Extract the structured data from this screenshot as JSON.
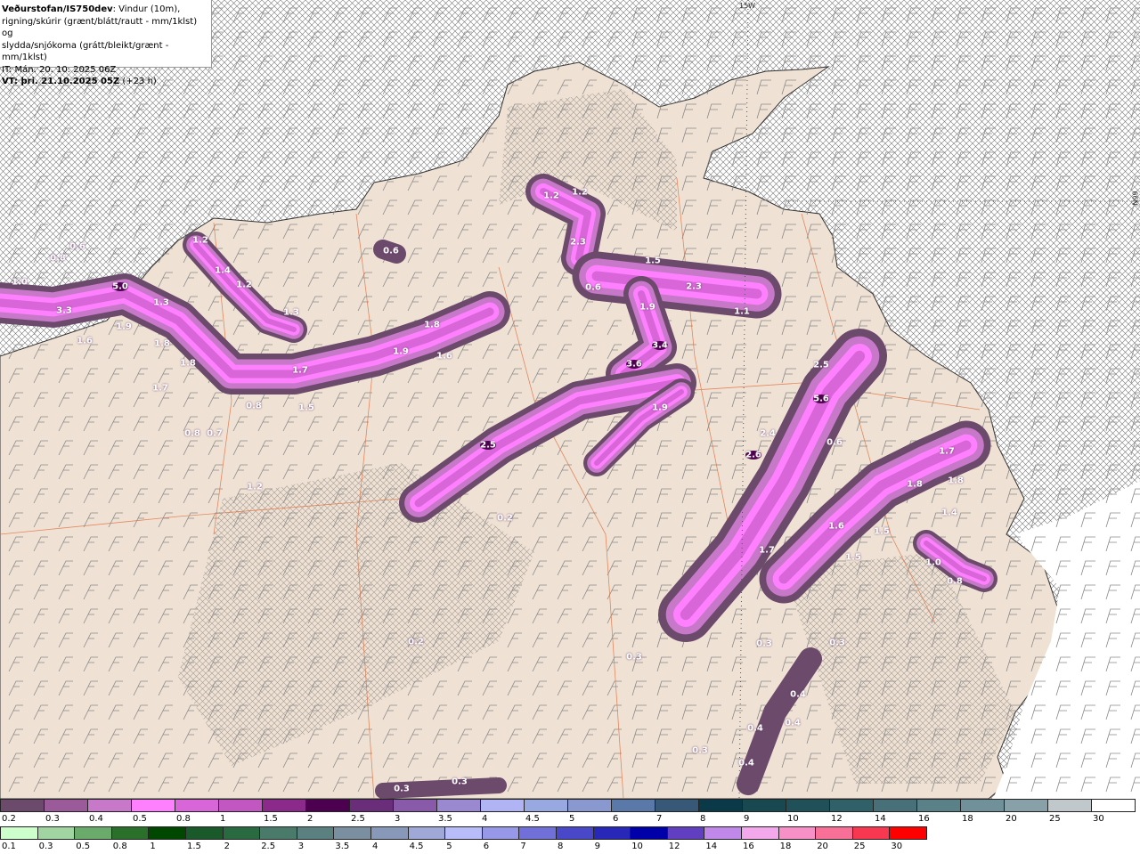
{
  "header": {
    "source": "Veðurstofan/IS750dev",
    "description_1": ": Vindur (10m),",
    "description_2": "rigning/skúrir (grænt/blátt/rautt - mm/1klst) og",
    "description_3": "slydda/snjókoma (grátt/bleikt/grænt - mm/1klst)",
    "initial_time": "IT: Mán. 20. 10. 2025 06Z",
    "valid_time": "VT: þri. 21.10.2025 05Z",
    "lead_time": "(+23 h)"
  },
  "grid_labels": {
    "longitude": "15W",
    "latitude": "66N"
  },
  "map": {
    "labels": [
      "0.6",
      "0.8",
      "1.0",
      "5.0",
      "3.3",
      "1.2",
      "1.4",
      "1.2",
      "1.3",
      "1.3",
      "1.9",
      "1.6",
      "1.8",
      "1.8",
      "1.7",
      "1.7",
      "1.5",
      "0.8",
      "0.8",
      "0.7",
      "1.2",
      "0.6",
      "1.8",
      "1.9",
      "1.6",
      "1.2",
      "1.2",
      "2.3",
      "1.5",
      "0.6",
      "2.3",
      "1.9",
      "1.1",
      "3.4",
      "3.6",
      "1.9",
      "2.5",
      "0.2",
      "2.5",
      "5.6",
      "2.4",
      "2.6",
      "0.6",
      "1.7",
      "1.8",
      "1.8",
      "1.4",
      "1.6",
      "1.5",
      "1.7",
      "1.5",
      "1.0",
      "0.8",
      "0.2",
      "0.3",
      "0.3",
      "0.3",
      "0.4",
      "0.4",
      "0.4",
      "0.3",
      "0.4",
      "0.3",
      "0.3"
    ],
    "colors": {
      "sea": "#ffffff",
      "land": "#efe2d4",
      "border": "#e07040",
      "coast": "#333333",
      "wind_barb": "#888888"
    },
    "icons": [
      "wind-barb-icon"
    ]
  },
  "legend_snow": {
    "ticks": [
      "0.2",
      "0.3",
      "0.4",
      "0.5",
      "0.8",
      "1",
      "1.5",
      "2",
      "2.5",
      "3",
      "3.5",
      "4",
      "4.5",
      "5",
      "6",
      "7",
      "8",
      "9",
      "10",
      "12",
      "14",
      "16",
      "18",
      "20",
      "25",
      "30"
    ],
    "colors": [
      "#6b4a6b",
      "#9b5b9b",
      "#c878c8",
      "#ff80ff",
      "#d966d9",
      "#c257c2",
      "#8b2a8b",
      "#4d0050",
      "#6a2d7a",
      "#8a5aaa",
      "#9a88d0",
      "#b0b4f4",
      "#98a8e0",
      "#8a98d0",
      "#5a78a8",
      "#385878",
      "#0a3a48",
      "#184850",
      "#205058",
      "#306068",
      "#487078",
      "#5a8088",
      "#70909a",
      "#88a0a8",
      "#c0c8cc",
      "#ffffff"
    ]
  },
  "legend_rain": {
    "ticks": [
      "0.1",
      "0.3",
      "0.5",
      "0.8",
      "1",
      "1.5",
      "2",
      "2.5",
      "3",
      "3.5",
      "4",
      "4.5",
      "5",
      "6",
      "7",
      "8",
      "9",
      "10",
      "12",
      "14",
      "16",
      "18",
      "20",
      "25",
      "30"
    ],
    "colors": [
      "#ccffcc",
      "#a0d4a0",
      "#6aaa6a",
      "#2a702a",
      "#004800",
      "#1a5a2a",
      "#2a6a40",
      "#4a7a6a",
      "#5a8080",
      "#7a90a0",
      "#8898b8",
      "#a0a8d8",
      "#b8bcf8",
      "#9898e8",
      "#7070d8",
      "#4848c8",
      "#2828b8",
      "#0000a8",
      "#6040c0",
      "#c088e8",
      "#f4a8ec",
      "#f890c8",
      "#f87098",
      "#f83850",
      "#ff0000"
    ]
  }
}
